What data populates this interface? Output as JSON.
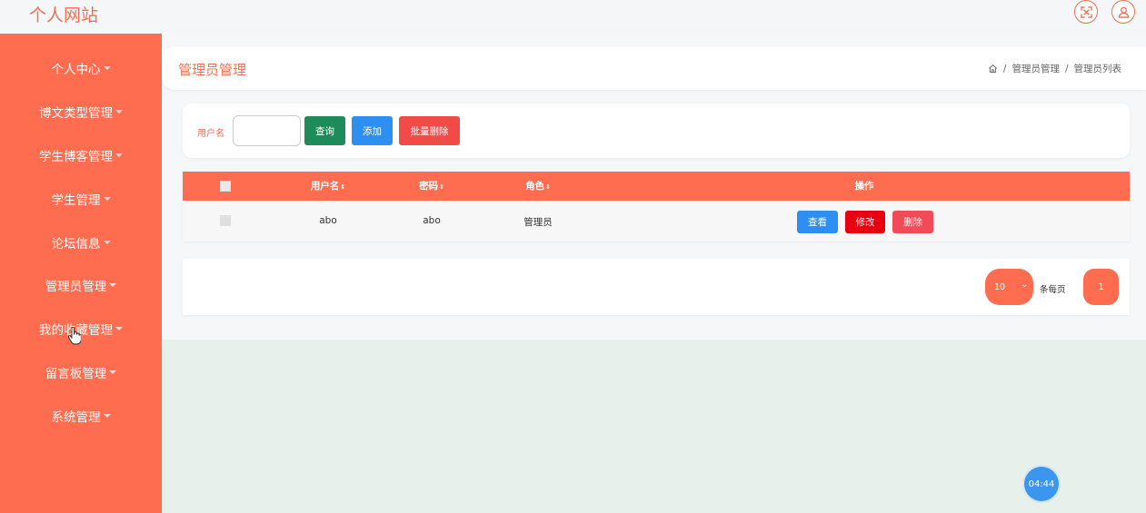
{
  "app": {
    "title": "个人网站"
  },
  "sidebar": {
    "items": [
      {
        "label": "个人中心"
      },
      {
        "label": "博文类型管理"
      },
      {
        "label": "学生博客管理"
      },
      {
        "label": "学生管理"
      },
      {
        "label": "论坛信息"
      },
      {
        "label": "管理员管理"
      },
      {
        "label": "我的收藏管理"
      },
      {
        "label": "留言板管理"
      },
      {
        "label": "系统管理"
      }
    ]
  },
  "header": {
    "title": "管理员管理",
    "breadcrumb": [
      "管理员管理",
      "管理员列表"
    ],
    "separator": "/"
  },
  "search": {
    "label": "用户名",
    "value": "",
    "query_label": "查询",
    "add_label": "添加",
    "batch_delete_label": "批量删除"
  },
  "table": {
    "columns": [
      "用户名",
      "密码",
      "角色",
      "操作"
    ],
    "sort_icon": "⇕",
    "rows": [
      {
        "username": "abo",
        "password": "abo",
        "role": "管理员"
      }
    ],
    "actions": {
      "view": "查看",
      "edit": "修改",
      "delete": "删除"
    }
  },
  "pagination": {
    "page_size": "10",
    "per_page_label": "条每页",
    "current_page": "1"
  },
  "timer": {
    "label": "04:44"
  },
  "colors": {
    "accent": "#fe6d4f",
    "title": "#f06f55",
    "query": "#1e8c5a",
    "primary": "#2e8ff2",
    "danger": "#f04b47",
    "edit": "#e60012"
  },
  "icons": {
    "fullscreen": "fullscreen-icon",
    "user": "user-icon",
    "home": "home-icon",
    "cursor": "hand-cursor-icon"
  }
}
